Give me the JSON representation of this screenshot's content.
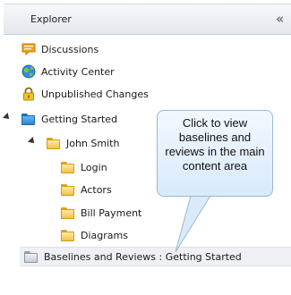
{
  "explorer": {
    "title": "Explorer",
    "collapse_glyph": "«"
  },
  "tree": {
    "discussions": "Discussions",
    "activity_center": "Activity Center",
    "unpublished_changes": "Unpublished Changes",
    "getting_started": "Getting Started",
    "john_smith": "John Smith",
    "login": "Login",
    "actors": "Actors",
    "bill_payment": "Bill Payment",
    "diagrams": "Diagrams",
    "baselines_reviews": "Baselines and Reviews : Getting Started"
  },
  "callout": {
    "text": "Click to view baselines and reviews in the main content area"
  },
  "icons": {
    "discussions": "speech-bubble-icon",
    "activity_center": "globe-icon",
    "unpublished_changes": "padlock-icon",
    "folder": "folder-icon"
  },
  "colors": {
    "header_bg": "#e9ecf0",
    "callout_bg": "#e3f0fc",
    "callout_border": "#98b8d8",
    "folder_yellow": "#f3c24c",
    "folder_blue": "#2d86d3"
  }
}
